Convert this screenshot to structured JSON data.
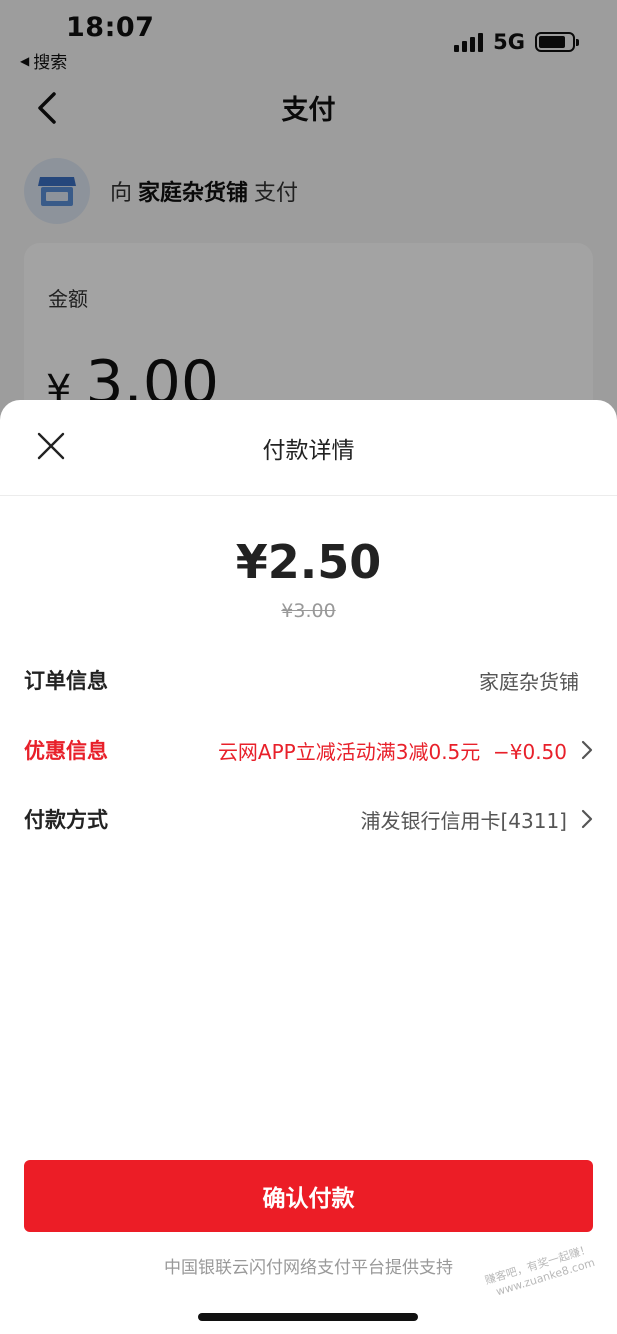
{
  "status_bar": {
    "time": "18:07",
    "back_app": "搜索",
    "network": "5G"
  },
  "nav": {
    "title": "支付"
  },
  "merchant": {
    "prefix": "向",
    "name": "家庭杂货铺",
    "suffix": "支付"
  },
  "amount_card": {
    "label": "金额",
    "currency": "¥",
    "value": "3.00"
  },
  "sheet": {
    "title": "付款详情",
    "pay_amount": "¥2.50",
    "original_amount": "¥3.00",
    "rows": [
      {
        "label": "订单信息",
        "value": "家庭杂货铺"
      },
      {
        "label": "优惠信息",
        "value": "云网APP立减活动满3减0.5元  −¥0.50"
      },
      {
        "label": "付款方式",
        "value": "浦发银行信用卡[4311]"
      }
    ],
    "confirm_label": "确认付款",
    "support_text": "中国银联云闪付网络支付平台提供支持",
    "watermark_line1": "赚客吧，有奖一起赚！",
    "watermark_line2": "www.zuanke8.com"
  },
  "colors": {
    "accent": "#ec1d26",
    "promo": "#e8202a",
    "overlay": "rgba(0,0,0,0.36)"
  },
  "icons": {
    "back": "chevron-left-icon",
    "merchant": "shop-icon",
    "close": "close-icon",
    "chevron": "chevron-right-icon"
  }
}
